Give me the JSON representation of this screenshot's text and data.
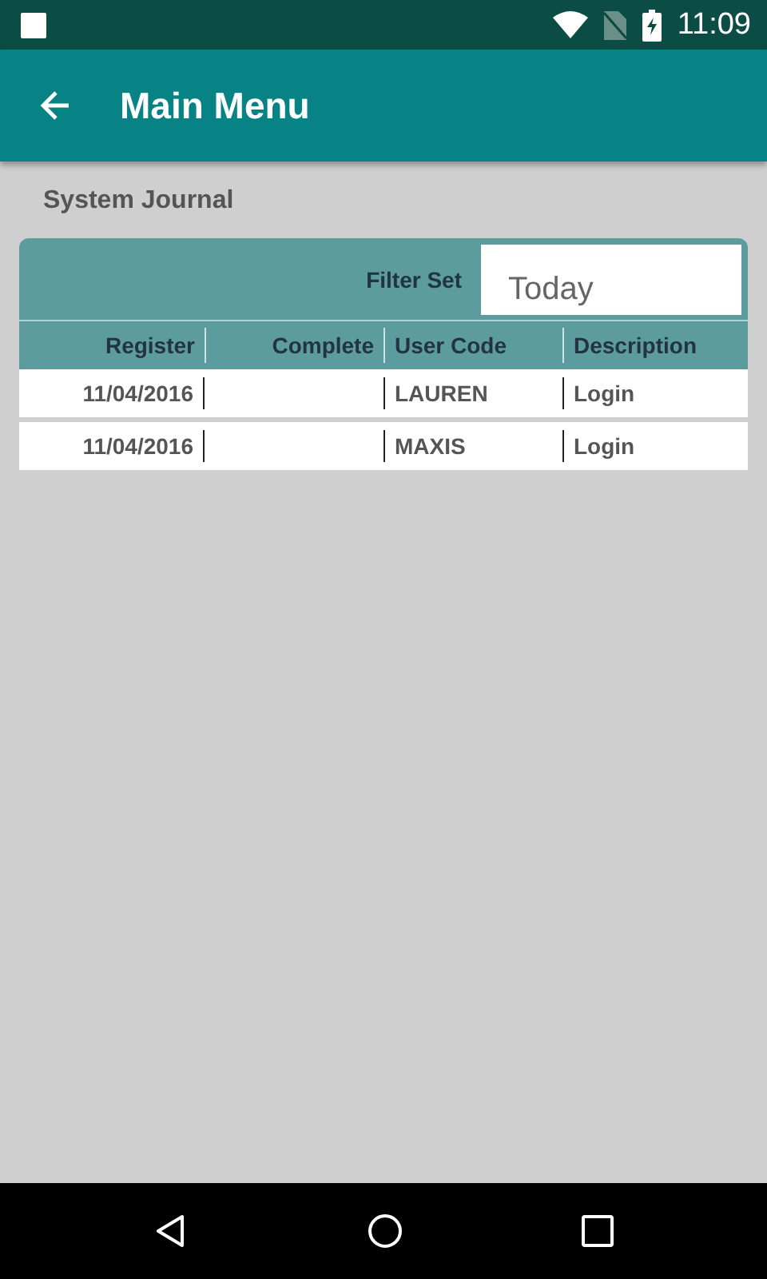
{
  "status_bar": {
    "time": "11:09"
  },
  "app_bar": {
    "title": "Main Menu"
  },
  "section_title": "System Journal",
  "filter": {
    "label": "Filter Set",
    "value": "Today"
  },
  "table": {
    "columns": [
      {
        "label": "Register",
        "kind": "date"
      },
      {
        "label": "Complete",
        "kind": "date"
      },
      {
        "label": "User Code",
        "kind": "text"
      },
      {
        "label": "Description",
        "kind": "text"
      }
    ],
    "rows": [
      [
        "11/04/2016",
        "",
        "LAUREN",
        "Login"
      ],
      [
        "11/04/2016",
        "",
        "MAXIS",
        "Login"
      ]
    ]
  }
}
